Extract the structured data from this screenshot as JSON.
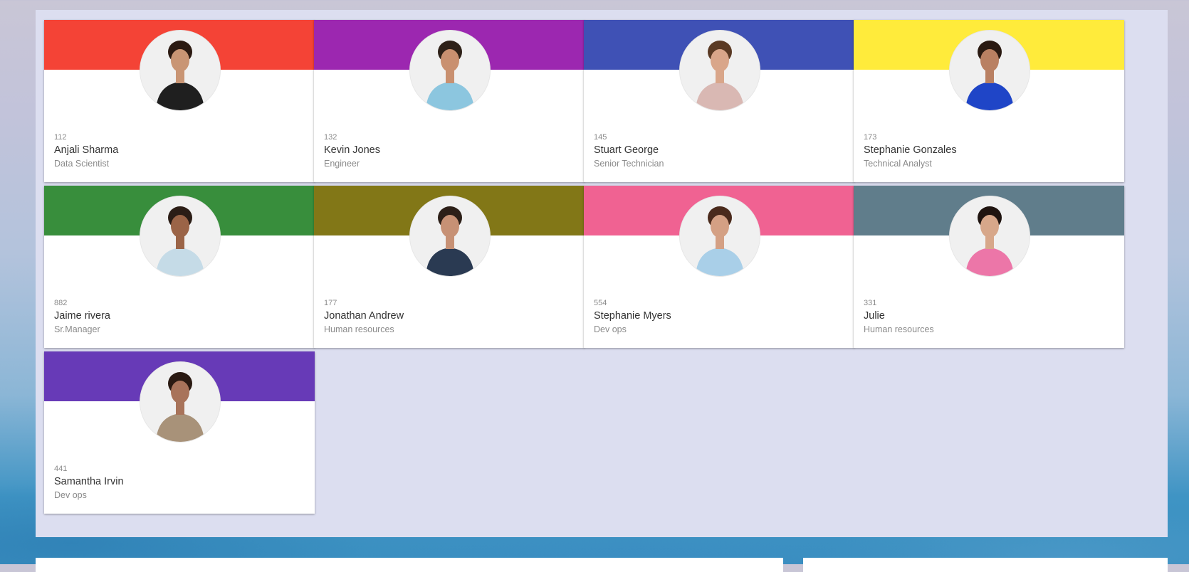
{
  "employees": [
    {
      "id": "112",
      "name": "Anjali Sharma",
      "role": "Data Scientist",
      "color": "#f44336",
      "shirt": "#1f1f1f",
      "skin": "#c99574",
      "hair": "#2b1a12"
    },
    {
      "id": "132",
      "name": "Kevin Jones",
      "role": "Engineer",
      "color": "#9c27b0",
      "shirt": "#8cc6df",
      "skin": "#c99070",
      "hair": "#2e2118"
    },
    {
      "id": "145",
      "name": "Stuart George",
      "role": "Senior Technician",
      "color": "#3f51b5",
      "shirt": "#d9b8b3",
      "skin": "#d9a68a",
      "hair": "#5a3a24"
    },
    {
      "id": "173",
      "name": "Stephanie Gonzales",
      "role": "Technical Analyst",
      "color": "#ffeb3b",
      "shirt": "#1f45c7",
      "skin": "#b98062",
      "hair": "#2a1a12"
    },
    {
      "id": "882",
      "name": "Jaime rivera",
      "role": "Sr.Manager",
      "color": "#388e3c",
      "shirt": "#c5dbe7",
      "skin": "#9b6447",
      "hair": "#2b1d16"
    },
    {
      "id": "177",
      "name": "Jonathan Andrew",
      "role": "Human resources",
      "color": "#827717",
      "shirt": "#2a3a52",
      "skin": "#c79175",
      "hair": "#2c1f18"
    },
    {
      "id": "554",
      "name": "Stephanie Myers",
      "role": "Dev ops",
      "color": "#f06292",
      "shirt": "#a9cfe8",
      "skin": "#d4a084",
      "hair": "#4a2a1c"
    },
    {
      "id": "331",
      "name": "Julie",
      "role": "Human resources",
      "color": "#607d8b",
      "shirt": "#ec76a8",
      "skin": "#d7a78a",
      "hair": "#1f1410"
    },
    {
      "id": "441",
      "name": "Samantha Irvin",
      "role": "Dev ops",
      "color": "#673ab7",
      "shirt": "#a89279",
      "skin": "#a8735a",
      "hair": "#2a1a12"
    }
  ]
}
